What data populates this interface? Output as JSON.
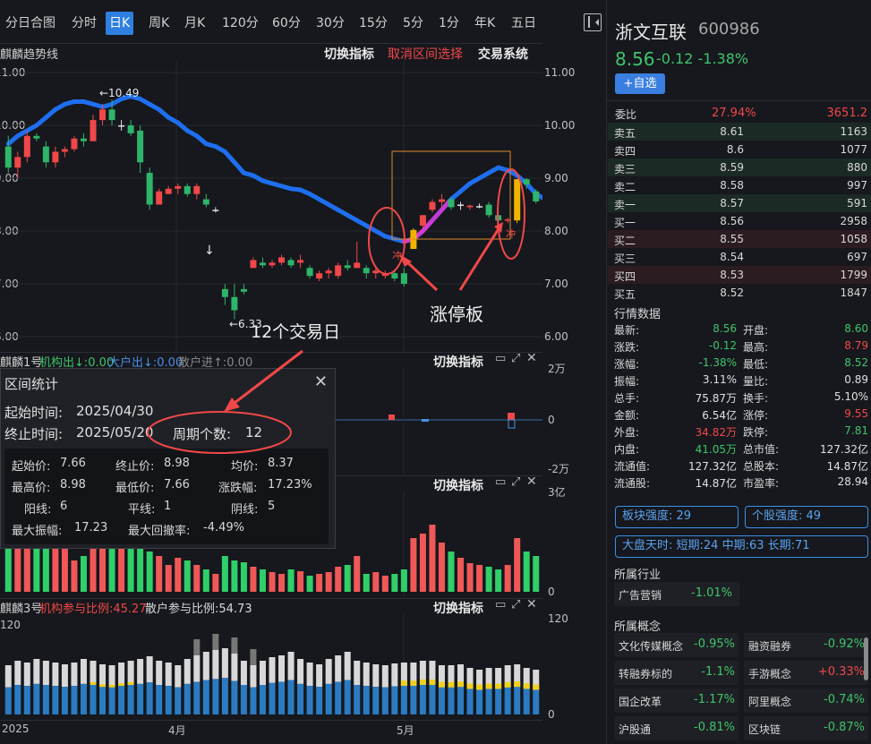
{
  "tabs": [
    "分日合图",
    "分时",
    "日K",
    "周K",
    "月K",
    "120分",
    "60分",
    "30分",
    "15分",
    "5分",
    "1分",
    "年K",
    "五日"
  ],
  "active_tab": "日K",
  "main_pane": {
    "indicator_name": "麒麟趋势线",
    "switch_label": "切换指标",
    "cancel_label": "取消区间选择",
    "system_label": "交易系统",
    "y_ticks": [
      "11.00",
      "10.00",
      "9.00",
      "8.00",
      "7.00",
      "6.00"
    ],
    "y_ticks_left": [
      "11.00",
      "10.00",
      "9.00",
      "8.00",
      "7.00",
      "6.00"
    ],
    "high_marker": "←10.49",
    "low_marker": "←6.33",
    "chong_1": "冲",
    "chong_2": "冲",
    "annot_days": "12个交易日",
    "annot_limit": "涨停板"
  },
  "pane2": {
    "name": "麒麟1号",
    "inst_out": "机构出↓:0.00",
    "big_out": "大户出↓:0.00",
    "retail_in": "散户进↑:0.00",
    "switch_label": "切换指标",
    "y_top": "2万",
    "y_mid": "0",
    "y_bot": "-2万"
  },
  "pane3": {
    "switch_label": "切换指标",
    "y_top": "3亿",
    "y_bot": "0"
  },
  "pane4": {
    "name": "麒麟3号",
    "inst_ratio": "机构参与比例:45.27",
    "retail_ratio": "散户参与比例:54.73",
    "switch_label": "切换指标",
    "y_top": "120",
    "y_left_top": "120",
    "y_bot": "0",
    "x_labels": [
      "2025",
      "4月",
      "5月"
    ]
  },
  "popup": {
    "title": "区间统计",
    "start_label": "起始时间:",
    "start_value": "2025/04/30",
    "end_label": "终止时间:",
    "end_value": "2025/05/20",
    "period_label": "周期个数:",
    "period_value": "12",
    "stats": {
      "start_price_label": "起始价:",
      "start_price": "7.66",
      "end_price_label": "终止价:",
      "end_price": "8.98",
      "avg_label": "均价:",
      "avg": "8.37",
      "high_label": "最高价:",
      "high": "8.98",
      "low_label": "最低价:",
      "low": "7.66",
      "chg_label": "涨跌幅:",
      "chg": "17.23%",
      "yang_label": "阳线:",
      "yang": "6",
      "flat_label": "平线:",
      "flat": "1",
      "yin_label": "阴线:",
      "yin": "5",
      "amp_label": "最大振幅:",
      "amp": "17.23",
      "dd_label": "最大回撤率:",
      "dd": "-4.49%"
    }
  },
  "side": {
    "name": "浙文互联",
    "code": "600986",
    "price": "8.56",
    "change": "-0.12 -1.38%",
    "add_label": "+自选",
    "weibi_label": "委比",
    "weibi_pct": "27.94%",
    "weibi_val": "3651.2",
    "orderbook": [
      {
        "label": "卖五",
        "price": "8.61",
        "vol": "1163"
      },
      {
        "label": "卖四",
        "price": "8.6",
        "vol": "1077"
      },
      {
        "label": "卖三",
        "price": "8.59",
        "vol": "880"
      },
      {
        "label": "卖二",
        "price": "8.58",
        "vol": "997"
      },
      {
        "label": "卖一",
        "price": "8.57",
        "vol": "591"
      },
      {
        "label": "买一",
        "price": "8.56",
        "vol": "2958"
      },
      {
        "label": "买二",
        "price": "8.55",
        "vol": "1058"
      },
      {
        "label": "买三",
        "price": "8.54",
        "vol": "697"
      },
      {
        "label": "买四",
        "price": "8.53",
        "vol": "1799"
      },
      {
        "label": "买五",
        "price": "8.52",
        "vol": "1847"
      }
    ],
    "quote_title": "行情数据",
    "quotes": [
      [
        "最新:",
        "8.56",
        "g",
        "开盘:",
        "8.60",
        "g"
      ],
      [
        "涨跌:",
        "-0.12",
        "g",
        "最高:",
        "8.79",
        "r"
      ],
      [
        "涨幅:",
        "-1.38%",
        "g",
        "最低:",
        "8.52",
        "g"
      ],
      [
        "振幅:",
        "3.11%",
        "w",
        "量比:",
        "0.89",
        "w"
      ],
      [
        "总手:",
        "75.87万",
        "w",
        "换手:",
        "5.10%",
        "w"
      ],
      [
        "金额:",
        "6.54亿",
        "w",
        "涨停:",
        "9.55",
        "r"
      ],
      [
        "外盘:",
        "34.82万",
        "r",
        "跌停:",
        "7.81",
        "g"
      ],
      [
        "内盘:",
        "41.05万",
        "g",
        "总市值:",
        "127.32亿",
        "w"
      ],
      [
        "流通值:",
        "127.32亿",
        "w",
        "总股本:",
        "14.87亿",
        "w"
      ],
      [
        "流通股:",
        "14.87亿",
        "w",
        "市盈率:",
        "28.94",
        "w"
      ]
    ],
    "sector_strength_label": "板块强度:",
    "sector_strength": "29",
    "stock_strength_label": "个股强度:",
    "stock_strength": "49",
    "market_label": "大盘天时:",
    "market_value": "短期:24 中期:63 长期:71",
    "industry_title": "所属行业",
    "industry": {
      "name": "广告营销",
      "chg": "-1.01%"
    },
    "concept_title": "所属概念",
    "concepts": [
      {
        "name": "文化传媒概念",
        "chg": "-0.95%",
        "c": "g"
      },
      {
        "name": "融资融券",
        "chg": "-0.92%",
        "c": "g"
      },
      {
        "name": "转融券标的",
        "chg": "-1.1%",
        "c": "g"
      },
      {
        "name": "手游概念",
        "chg": "+0.33%",
        "c": "r"
      },
      {
        "name": "国企改革",
        "chg": "-1.17%",
        "c": "g"
      },
      {
        "name": "阿里概念",
        "chg": "-0.74%",
        "c": "g"
      },
      {
        "name": "沪股通",
        "chg": "-0.81%",
        "c": "g"
      },
      {
        "name": "区块链",
        "chg": "-0.87%",
        "c": "g"
      }
    ]
  },
  "chart_data": {
    "type": "candlestick",
    "candles": [
      [
        9.6,
        9.8,
        9.1,
        9.2
      ],
      [
        9.2,
        9.5,
        9.0,
        9.4
      ],
      [
        9.4,
        9.9,
        9.3,
        9.8
      ],
      [
        9.8,
        9.85,
        9.7,
        9.75
      ],
      [
        9.6,
        9.7,
        9.2,
        9.3
      ],
      [
        9.3,
        9.6,
        9.2,
        9.5
      ],
      [
        9.5,
        9.6,
        9.4,
        9.55
      ],
      [
        9.55,
        9.8,
        9.5,
        9.75
      ],
      [
        9.75,
        9.85,
        9.6,
        9.7
      ],
      [
        9.7,
        10.2,
        9.7,
        10.1
      ],
      [
        10.1,
        10.4,
        10.0,
        10.3
      ],
      [
        10.3,
        10.49,
        10.0,
        10.1
      ],
      [
        10.0,
        10.1,
        9.9,
        10.0
      ],
      [
        10.0,
        10.1,
        9.8,
        9.85
      ],
      [
        9.9,
        10.0,
        9.1,
        9.3
      ],
      [
        9.1,
        9.2,
        8.4,
        8.5
      ],
      [
        8.5,
        8.8,
        8.5,
        8.75
      ],
      [
        8.7,
        8.85,
        8.7,
        8.8
      ],
      [
        8.8,
        8.9,
        8.7,
        8.85
      ],
      [
        8.85,
        8.9,
        8.65,
        8.7
      ],
      [
        8.7,
        8.9,
        8.6,
        8.85
      ],
      [
        8.6,
        8.7,
        8.45,
        8.5
      ],
      [
        8.4,
        8.45,
        8.35,
        8.4
      ],
      [
        6.9,
        7.0,
        6.6,
        6.75
      ],
      [
        6.75,
        7.0,
        6.33,
        6.5
      ],
      [
        6.9,
        7.0,
        6.8,
        6.85
      ],
      [
        7.3,
        7.5,
        7.3,
        7.45
      ],
      [
        7.4,
        7.5,
        7.3,
        7.35
      ],
      [
        7.35,
        7.45,
        7.3,
        7.4
      ],
      [
        7.4,
        7.55,
        7.35,
        7.5
      ],
      [
        7.45,
        7.5,
        7.3,
        7.35
      ],
      [
        7.4,
        7.55,
        7.3,
        7.45
      ],
      [
        7.3,
        7.35,
        7.1,
        7.15
      ],
      [
        7.1,
        7.25,
        7.05,
        7.2
      ],
      [
        7.2,
        7.3,
        7.1,
        7.25
      ],
      [
        7.15,
        7.4,
        7.1,
        7.35
      ],
      [
        7.35,
        7.45,
        7.25,
        7.3
      ],
      [
        7.3,
        7.8,
        7.3,
        7.4
      ],
      [
        7.3,
        7.35,
        7.1,
        7.2
      ],
      [
        7.2,
        7.3,
        7.1,
        7.25
      ],
      [
        7.15,
        7.25,
        7.1,
        7.2
      ],
      [
        7.2,
        7.25,
        7.05,
        7.1
      ],
      [
        7.2,
        7.3,
        6.95,
        7.0
      ],
      [
        7.66,
        8.05,
        7.66,
        8.02
      ],
      [
        8.1,
        8.3,
        8.05,
        8.3
      ],
      [
        8.4,
        8.6,
        8.35,
        8.55
      ],
      [
        8.55,
        8.7,
        8.45,
        8.6
      ],
      [
        8.6,
        8.65,
        8.4,
        8.45
      ],
      [
        8.5,
        8.55,
        8.4,
        8.5
      ],
      [
        8.45,
        8.5,
        8.4,
        8.48
      ],
      [
        8.47,
        8.52,
        8.43,
        8.47
      ],
      [
        8.5,
        8.55,
        8.25,
        8.3
      ],
      [
        8.3,
        8.4,
        8.1,
        8.2
      ],
      [
        8.2,
        8.25,
        8.15,
        8.22
      ],
      [
        8.2,
        8.98,
        8.15,
        8.98
      ],
      [
        8.98,
        9.0,
        8.8,
        8.88
      ],
      [
        8.75,
        8.79,
        8.52,
        8.56
      ]
    ],
    "trend_line": [
      9.65,
      9.8,
      9.9,
      10.0,
      10.15,
      10.3,
      10.4,
      10.45,
      10.45,
      10.4,
      10.35,
      10.4,
      10.5,
      10.55,
      10.5,
      10.4,
      10.3,
      10.15,
      10.05,
      9.9,
      9.8,
      9.65,
      9.6,
      9.5,
      9.3,
      9.1,
      9.05,
      8.95,
      8.9,
      8.85,
      8.8,
      8.78,
      8.7,
      8.6,
      8.5,
      8.4,
      8.3,
      8.2,
      8.1,
      8.0,
      7.9,
      7.85,
      7.8,
      7.85,
      8.0,
      8.2,
      8.4,
      8.6,
      8.75,
      8.9,
      9.0,
      9.1,
      9.2,
      9.15,
      9.05,
      8.9,
      8.7,
      8.6
    ],
    "volume": [],
    "ylim": [
      6.0,
      11.0
    ]
  }
}
